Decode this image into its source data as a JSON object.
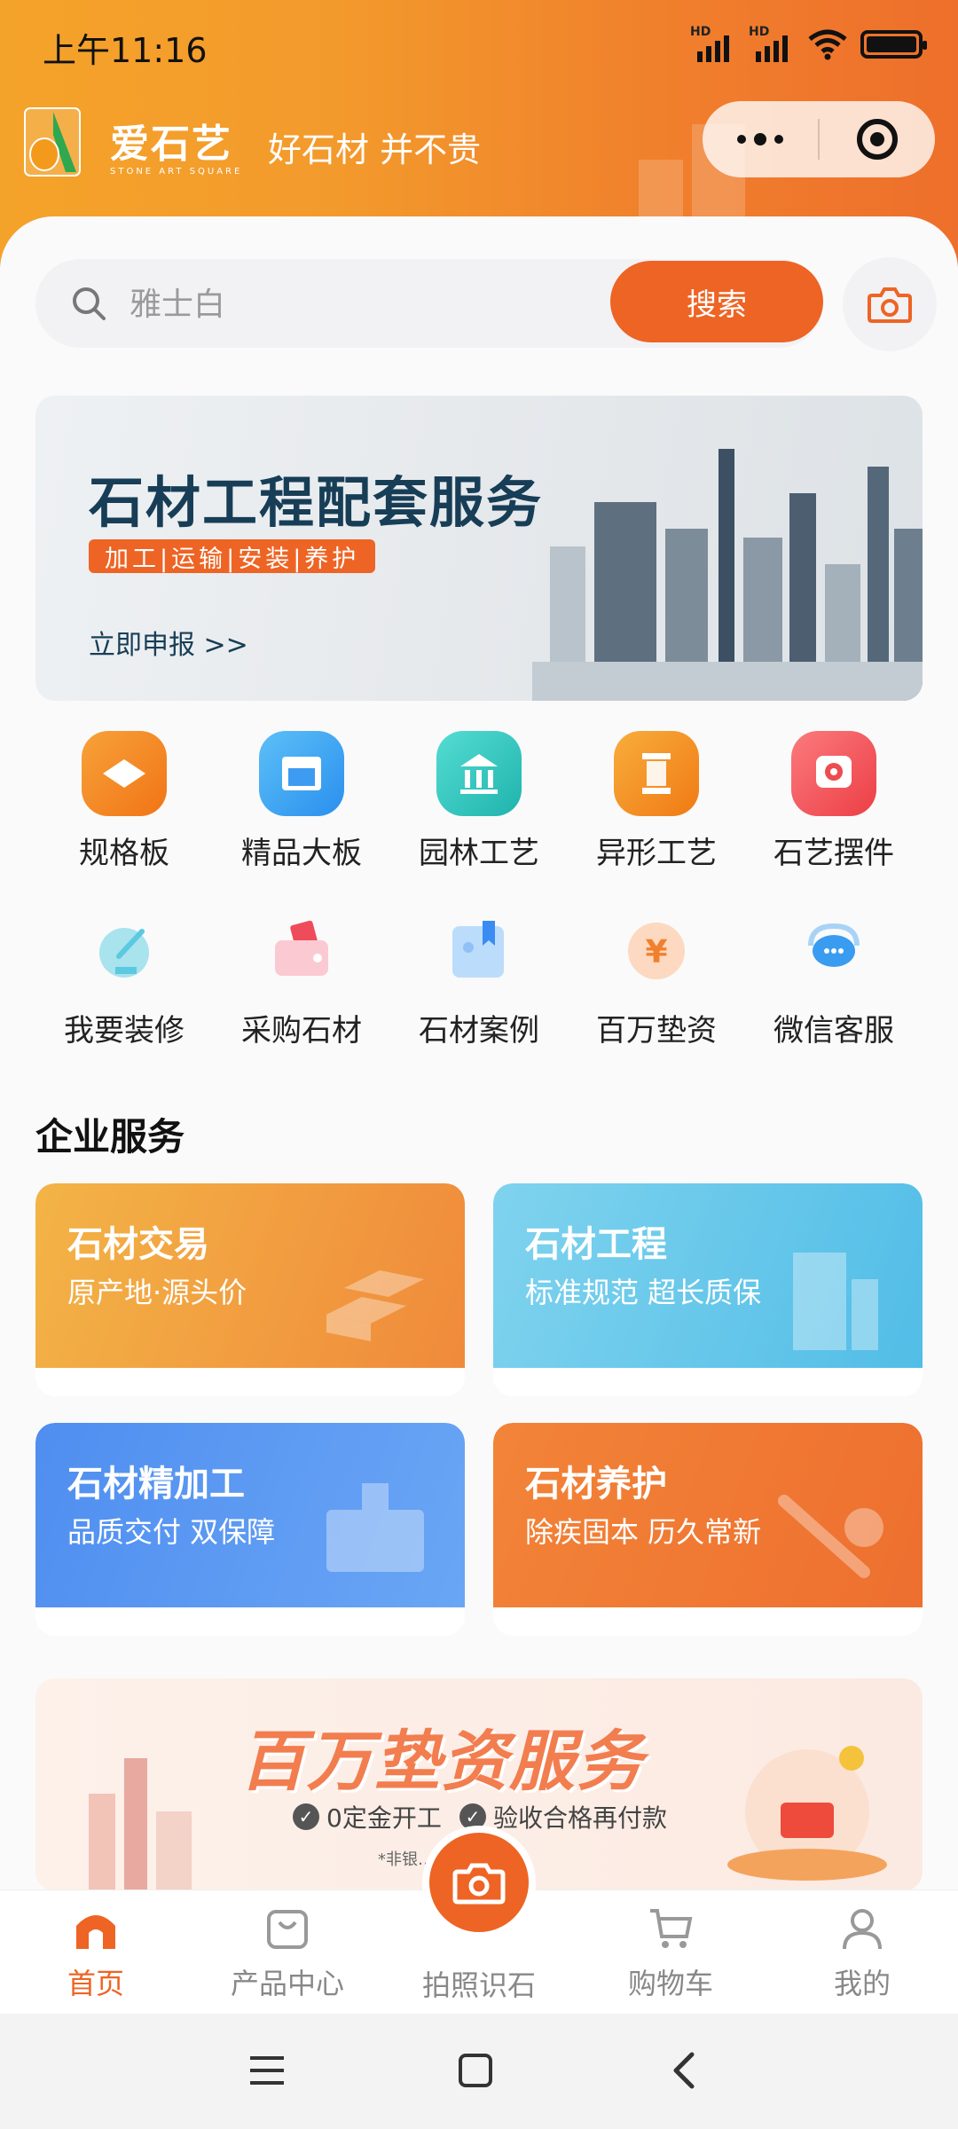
{
  "status_bar": {
    "time": "上午11:16",
    "signal1_label": "HD",
    "signal2_label": "HD"
  },
  "header": {
    "brand_name": "爱石艺",
    "brand_sub": "STONE ART SQUARE",
    "slogan": "好石材 并不贵"
  },
  "search": {
    "placeholder": "雅士白",
    "button_label": "搜索"
  },
  "banner_engineering": {
    "title": "石材工程配套服务",
    "tags": "加工|运输|安装|养护",
    "cta": "立即申报 >>"
  },
  "categories": [
    {
      "label": "规格板",
      "color": "#f58a1f"
    },
    {
      "label": "精品大板",
      "color": "#3aa5f2"
    },
    {
      "label": "园林工艺",
      "color": "#2fc9c2"
    },
    {
      "label": "异形工艺",
      "color": "#f49323"
    },
    {
      "label": "石艺摆件",
      "color": "#ef5457"
    },
    {
      "label": "我要装修",
      "color": "#5bc9e0"
    },
    {
      "label": "采购石材",
      "color": "#f4667b"
    },
    {
      "label": "石材案例",
      "color": "#5aa4f6"
    },
    {
      "label": "百万垫资",
      "color": "#f4a35d"
    },
    {
      "label": "微信客服",
      "color": "#3aa2ee"
    }
  ],
  "enterprise": {
    "title": "企业服务",
    "cards": [
      {
        "title": "石材交易",
        "subtitle": "原产地·源头价",
        "color_from": "#f3b446",
        "color_to": "#f08a3b"
      },
      {
        "title": "石材工程",
        "subtitle": "标准规范 超长质保",
        "color_from": "#7fd3ee",
        "color_to": "#52bde7"
      },
      {
        "title": "石材精加工",
        "subtitle": "品质交付 双保障",
        "color_from": "#4f8ef0",
        "color_to": "#6aa6f5"
      },
      {
        "title": "石材养护",
        "subtitle": "除疾固本 历久常新",
        "color_from": "#f28438",
        "color_to": "#ee6f2f"
      }
    ]
  },
  "banner_finance": {
    "title": "百万垫资服务",
    "point1": "0定金开工",
    "point2": "验收合格再付款",
    "note": "*非银…垫付"
  },
  "tabbar": {
    "home": "首页",
    "products": "产品中心",
    "photo": "拍照识石",
    "cart": "购物车",
    "me": "我的"
  },
  "colors": {
    "accent": "#ee6424",
    "header_from": "#f4a32a",
    "header_to": "#ee6f2b"
  }
}
